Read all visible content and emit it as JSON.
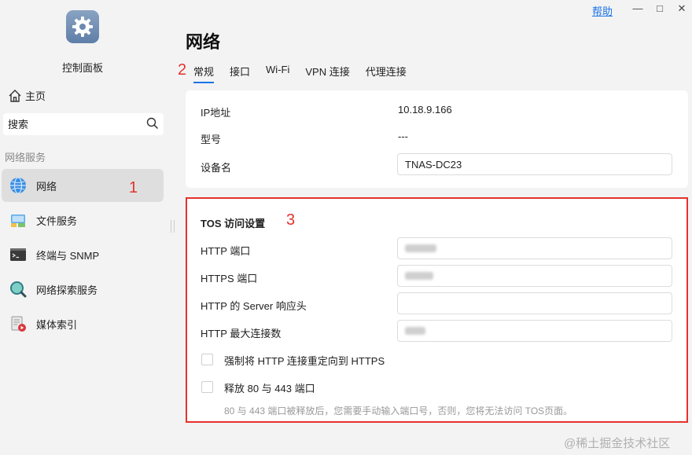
{
  "app": {
    "title": "控制面板",
    "icon": "gear-icon"
  },
  "sidebar": {
    "home_label": "主页",
    "search": {
      "value": "搜索",
      "placeholder": "搜索"
    },
    "section_label": "网络服务",
    "items": [
      {
        "label": "网络",
        "icon": "globe-icon"
      },
      {
        "label": "文件服务",
        "icon": "folder-network-icon"
      },
      {
        "label": "终端与 SNMP",
        "icon": "terminal-icon"
      },
      {
        "label": "网络探索服务",
        "icon": "magnifier-icon"
      },
      {
        "label": "媒体索引",
        "icon": "media-index-icon"
      }
    ]
  },
  "window": {
    "help_label": "帮助",
    "minimize": "—",
    "maximize": "□",
    "close": "✕"
  },
  "main": {
    "title": "网络",
    "tabs": [
      {
        "label": "常规"
      },
      {
        "label": "接口"
      },
      {
        "label": "Wi-Fi"
      },
      {
        "label": "VPN 连接"
      },
      {
        "label": "代理连接"
      }
    ],
    "info": {
      "ip_label": "IP地址",
      "ip_value": "10.18.9.166",
      "model_label": "型号",
      "model_value": "---",
      "device_label": "设备名",
      "device_value": "TNAS-DC23"
    },
    "tos": {
      "title": "TOS 访问设置",
      "http_port_label": "HTTP 端口",
      "https_port_label": "HTTPS 端口",
      "server_header_label": "HTTP 的 Server 响应头",
      "server_header_value": "",
      "max_conn_label": "HTTP 最大连接数",
      "redirect_label": "强制将 HTTP 连接重定向到 HTTPS",
      "release_label": "释放 80 与 443 端口",
      "release_hint": "80 与 443 端口被释放后，您需要手动输入端口号，否则，您将无法访问 TOS页面。"
    }
  },
  "annotations": {
    "a1": "1",
    "a2": "2",
    "a3": "3"
  },
  "watermark": "@稀土掘金技术社区",
  "colors": {
    "accent": "#1a73e8",
    "annotation": "#e5322d",
    "background": "#f3f3f3"
  }
}
